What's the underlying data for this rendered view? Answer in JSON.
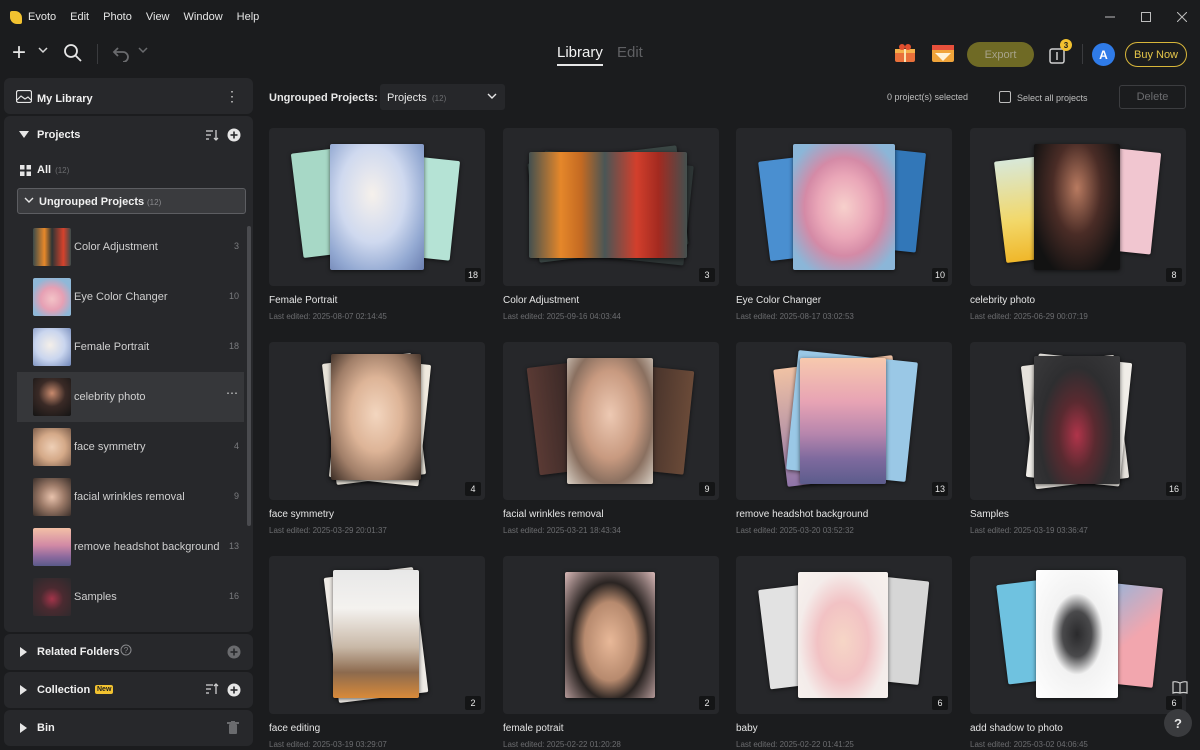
{
  "app": {
    "name": "Evoto"
  },
  "menu": [
    "Edit",
    "Photo",
    "View",
    "Window",
    "Help"
  ],
  "toolbar": {
    "mode_tabs": [
      "Library",
      "Edit"
    ],
    "export_label": "Export",
    "batch_badge": "3",
    "avatar_letter": "A",
    "buynow_label": "Buy Now"
  },
  "sidebar": {
    "my_library": "My Library",
    "projects_label": "Projects",
    "all_label": "All",
    "all_count": "(12)",
    "ungrouped_label": "Ungrouped Projects",
    "ungrouped_count": "(12)",
    "projects": [
      {
        "name": "Color Adjustment",
        "count": "3"
      },
      {
        "name": "Eye Color Changer",
        "count": "10"
      },
      {
        "name": "Female Portrait",
        "count": "18"
      },
      {
        "name": "celebrity photo",
        "count": ""
      },
      {
        "name": "face symmetry",
        "count": "4"
      },
      {
        "name": "facial wrinkles removal",
        "count": "9"
      },
      {
        "name": "remove headshot background",
        "count": "13"
      },
      {
        "name": "Samples",
        "count": "16"
      }
    ],
    "related_folders": "Related Folders",
    "collection": "Collection",
    "new_badge": "New",
    "bin": "Bin"
  },
  "main": {
    "header_label": "Ungrouped Projects:",
    "select_value": "Projects",
    "select_count": "(12)",
    "selected_text": "0 project(s) selected",
    "select_all": "Select all projects",
    "delete_label": "Delete"
  },
  "cards": [
    {
      "name": "Female Portrait",
      "date": "Last edited: 2025-08-07 02:14:45",
      "count": "18"
    },
    {
      "name": "Color Adjustment",
      "date": "Last edited: 2025-09-16 04:03:44",
      "count": "3"
    },
    {
      "name": "Eye Color Changer",
      "date": "Last edited: 2025-08-17 03:02:53",
      "count": "10"
    },
    {
      "name": "celebrity photo",
      "date": "Last edited: 2025-06-29 00:07:19",
      "count": "8"
    },
    {
      "name": "face symmetry",
      "date": "Last edited: 2025-03-29 20:01:37",
      "count": "4"
    },
    {
      "name": "facial wrinkles removal",
      "date": "Last edited: 2025-03-21 18:43:34",
      "count": "9"
    },
    {
      "name": "remove headshot background",
      "date": "Last edited: 2025-03-20 03:52:32",
      "count": "13"
    },
    {
      "name": "Samples",
      "date": "Last edited: 2025-03-19 03:36:47",
      "count": "16"
    },
    {
      "name": "face editing",
      "date": "Last edited: 2025-03-19 03:29:07",
      "count": "2"
    },
    {
      "name": "female potrait",
      "date": "Last edited: 2025-02-22 01:20:28",
      "count": "2"
    },
    {
      "name": "baby",
      "date": "Last edited: 2025-02-22 01:41:25",
      "count": "6"
    },
    {
      "name": "add shadow to photo",
      "date": "Last edited: 2025-03-02 04:06:45",
      "count": "6"
    }
  ],
  "colors": {
    "accent": "#f2c230",
    "export_bg": "#6f6a25",
    "avatar": "#2f7be8"
  }
}
